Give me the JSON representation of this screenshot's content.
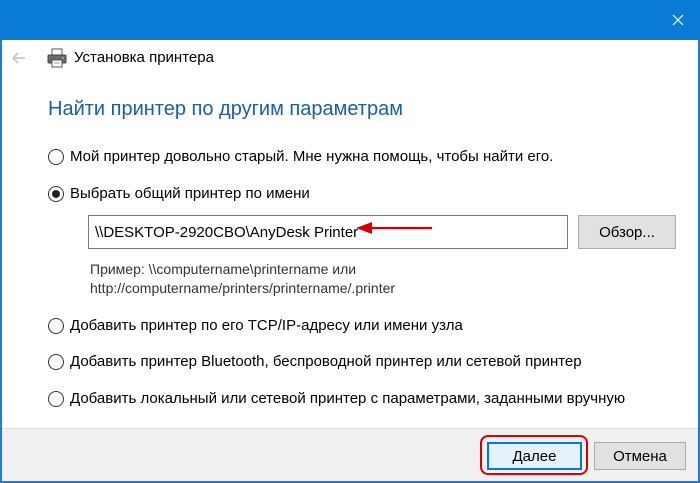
{
  "window": {
    "title": "Установка принтера"
  },
  "heading": "Найти принтер по другим параметрам",
  "options": [
    {
      "label": "Мой принтер довольно старый. Мне нужна помощь, чтобы найти его.",
      "checked": false
    },
    {
      "label": "Выбрать общий принтер по имени",
      "checked": true
    },
    {
      "label": "Добавить принтер по его TCP/IP-адресу или имени узла",
      "checked": false
    },
    {
      "label": "Добавить принтер Bluetooth, беспроводной принтер или сетевой принтер",
      "checked": false
    },
    {
      "label": "Добавить локальный или сетевой принтер с параметрами, заданными вручную",
      "checked": false
    }
  ],
  "printer_path": {
    "value": "\\\\DESKTOP-2920CBO\\AnyDesk Printer"
  },
  "browse_label": "Обзор...",
  "example": {
    "line1": "Пример: \\\\computername\\printername или",
    "line2": "http://computername/printers/printername/.printer"
  },
  "footer": {
    "next_label": "Далее",
    "cancel_label": "Отмена"
  },
  "colors": {
    "titlebar": "#0b7bd8",
    "heading": "#1a5fa8",
    "annotation": "#d40000"
  },
  "icons": {
    "close": "close-icon",
    "back": "back-arrow-icon",
    "printer": "printer-icon",
    "annotation": "red-arrow-icon"
  }
}
